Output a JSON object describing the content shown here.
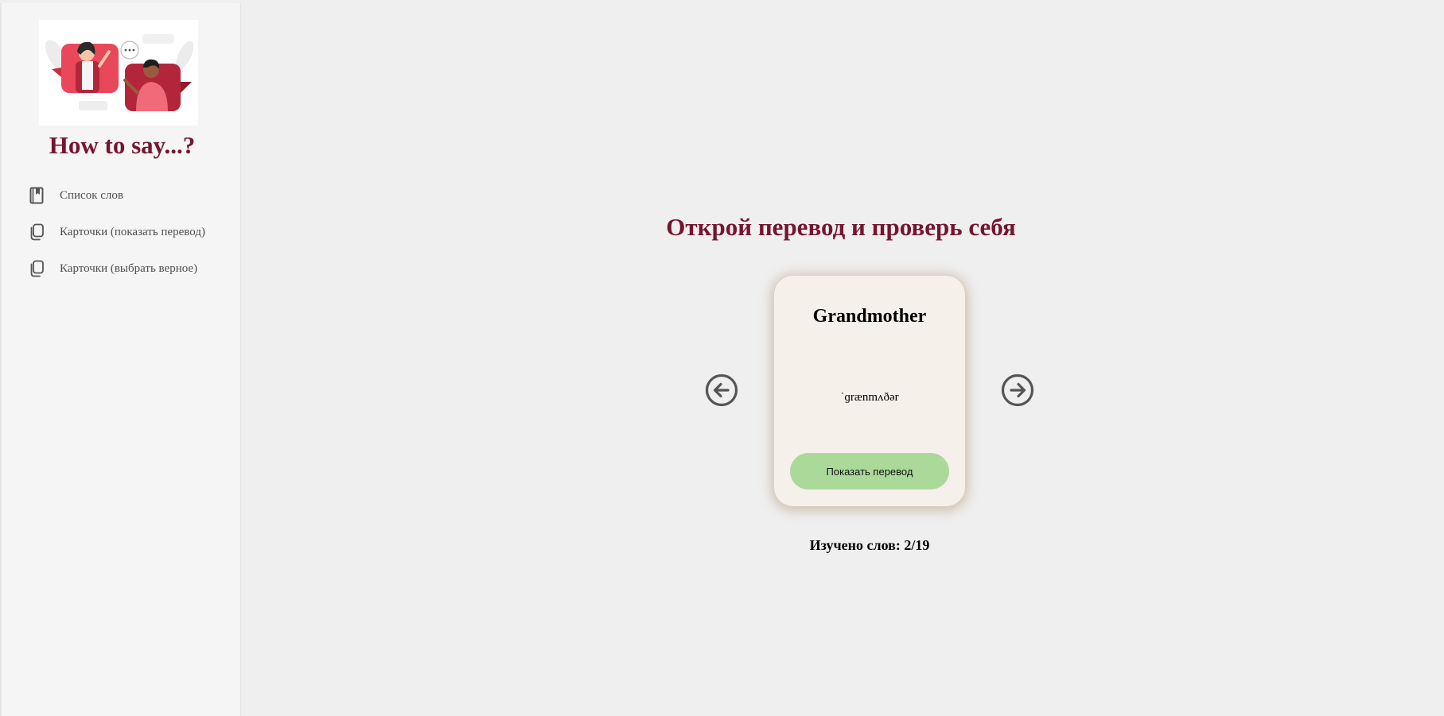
{
  "sidebar": {
    "app_title": "How to say...?",
    "items": [
      {
        "label": "Список слов",
        "icon": "book-icon"
      },
      {
        "label": "Карточки (показать перевод)",
        "icon": "copy-cards-icon"
      },
      {
        "label": "Карточки (выбрать верное)",
        "icon": "copy-cards-icon"
      }
    ]
  },
  "main": {
    "heading": "Открой перевод и проверь себя",
    "card": {
      "word": "Grandmother",
      "transcription": "ˈɡrænmʌðər",
      "show_button_label": "Показать перевод"
    },
    "progress_text": "Изучено слов: 2/19",
    "prev_icon": "arrow-left-circle-icon",
    "next_icon": "arrow-right-circle-icon"
  },
  "colors": {
    "accent": "#75152f",
    "card_bg": "#f6f0ea",
    "button_bg": "#abd99a",
    "sidebar_bg": "#f6f5f5",
    "page_bg": "#efefef"
  }
}
